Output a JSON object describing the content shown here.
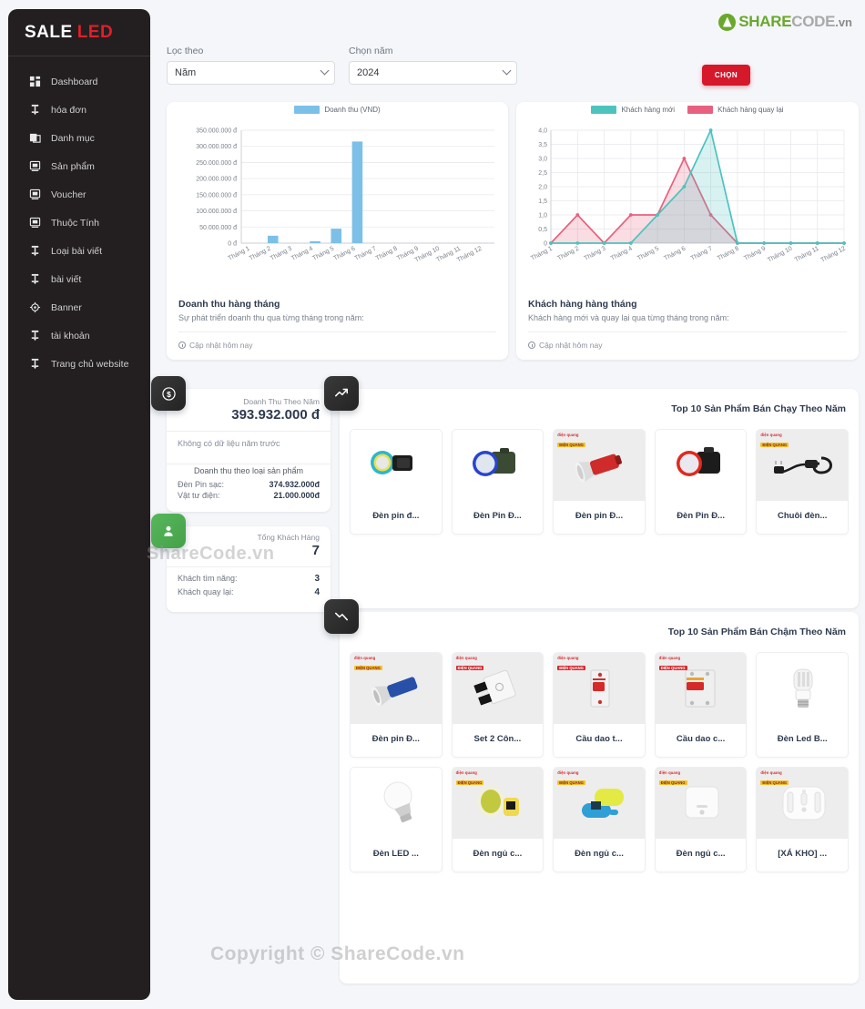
{
  "brand": {
    "part1": "SALE",
    "part2": "LED"
  },
  "sidebar": {
    "items": [
      {
        "label": "Dashboard",
        "icon": "dashboard-grid-icon"
      },
      {
        "label": "hóa đơn",
        "icon": "invoice-icon"
      },
      {
        "label": "Danh mục",
        "icon": "category-icon"
      },
      {
        "label": "Sản phẩm",
        "icon": "product-icon"
      },
      {
        "label": "Voucher",
        "icon": "voucher-icon"
      },
      {
        "label": "Thuộc Tính",
        "icon": "attribute-icon"
      },
      {
        "label": "Loại bài viết",
        "icon": "post-type-icon"
      },
      {
        "label": "bài viết",
        "icon": "post-icon"
      },
      {
        "label": "Banner",
        "icon": "banner-icon"
      },
      {
        "label": "tài khoản",
        "icon": "account-icon"
      },
      {
        "label": "Trang chủ website",
        "icon": "home-icon"
      }
    ]
  },
  "logo": {
    "share": "SHARE",
    "code": "CODE",
    "vn": ".vn"
  },
  "filters": {
    "filter_by_label": "Lọc theo",
    "filter_by_value": "Năm",
    "year_label": "Chọn năm",
    "year_value": "2024",
    "submit_label": "CHỌN",
    "submit_color": "#d6182b"
  },
  "revenue_card": {
    "title": "Doanh thu hàng tháng",
    "subtitle": "Sự phát triển doanh thu qua từng tháng trong năm:",
    "footer": "Cập nhật hôm nay"
  },
  "customer_card": {
    "title": "Khách hàng hàng tháng",
    "subtitle": "Khách hàng mới và quay lại qua từng tháng trong năm:",
    "footer": "Cập nhật hôm nay"
  },
  "chart_data": [
    {
      "type": "bar",
      "title": "",
      "legend": [
        "Doanh thu (VND)"
      ],
      "legend_position": "top",
      "color": "#7cc0e8",
      "categories": [
        "Tháng 1",
        "Tháng 2",
        "Tháng 3",
        "Tháng 4",
        "Tháng 5",
        "Tháng 6",
        "Tháng 7",
        "Tháng 8",
        "Tháng 9",
        "Tháng 10",
        "Tháng 11",
        "Tháng 12"
      ],
      "values": [
        0,
        23000000,
        0,
        6000000,
        45000000,
        315000000,
        0,
        0,
        0,
        0,
        0,
        0
      ],
      "ytick_labels": [
        "0 đ",
        "50.000.000 đ",
        "100.000.000 đ",
        "150.000.000 đ",
        "200.000.000 đ",
        "250.000.000 đ",
        "300.000.000 đ",
        "350.000.000 đ"
      ],
      "ylim": [
        0,
        350000000
      ],
      "xlabel": "",
      "ylabel": "",
      "grid": true
    },
    {
      "type": "area",
      "title": "",
      "legend_position": "top",
      "categories": [
        "Tháng 1",
        "Tháng 2",
        "Tháng 3",
        "Tháng 4",
        "Tháng 5",
        "Tháng 6",
        "Tháng 7",
        "Tháng 8",
        "Tháng 9",
        "Tháng 10",
        "Tháng 11",
        "Tháng 12"
      ],
      "series": [
        {
          "name": "Khách hàng mới",
          "color": "#4ec3bd",
          "values": [
            0,
            0,
            0,
            0,
            1,
            2,
            4,
            0,
            0,
            0,
            0,
            0
          ]
        },
        {
          "name": "Khách hàng quay lại",
          "color": "#e8607f",
          "values": [
            0,
            1,
            0,
            1,
            1,
            3,
            1,
            0,
            0,
            0,
            0,
            0
          ]
        }
      ],
      "ytick_labels": [
        "0",
        "0,5",
        "1,0",
        "1,5",
        "2,0",
        "2,5",
        "3,0",
        "3,5",
        "4,0"
      ],
      "ylim": [
        0,
        4
      ],
      "xlabel": "",
      "ylabel": "",
      "grid": true
    }
  ],
  "stat_revenue": {
    "icon": "dollar-icon",
    "label": "Doanh Thu Theo Năm",
    "value": "393.932.000 đ",
    "note": "Không có dữ liệu năm trước",
    "breakdown_title": "Doanh thu theo loại sản phẩm",
    "rows": [
      {
        "label": "Đèn Pin sạc:",
        "value": "374.932.000đ"
      },
      {
        "label": "Vật tư điện:",
        "value": "21.000.000đ"
      }
    ]
  },
  "stat_customer": {
    "icon": "user-icon",
    "icon_color": "#4caf50",
    "label": "Tổng Khách Hàng",
    "value": "7",
    "rows": [
      {
        "label": "Khách tìm năng:",
        "value": "3"
      },
      {
        "label": "Khách quay lại:",
        "value": "4"
      }
    ]
  },
  "panel_top": {
    "icon": "trend-up-icon",
    "title": "Top 10 Sản Phẩm Bán Chạy Theo Năm",
    "products": [
      {
        "name": "Đèn pin đ...",
        "img": "headlamp-cyan",
        "badge": false
      },
      {
        "name": "Đèn Pin Đ...",
        "img": "headlamp-blue",
        "badge": false
      },
      {
        "name": "Đèn pin Đ...",
        "img": "flashlight-red",
        "badge": true,
        "badge_style": "yellow"
      },
      {
        "name": "Đèn Pin Đ...",
        "img": "headlamp-red",
        "badge": false
      },
      {
        "name": "Chuôi đèn...",
        "img": "lamp-socket-cord",
        "badge": true,
        "badge_style": "yellow"
      }
    ]
  },
  "panel_slow": {
    "icon": "trend-down-icon",
    "title": "Top 10 Sản Phẩm Bán Chậm Theo Năm",
    "products": [
      {
        "name": "Đèn pin Đ...",
        "img": "flashlight-blue",
        "badge": true,
        "badge_style": "yellow"
      },
      {
        "name": "Set 2 Côn...",
        "img": "switch-white",
        "badge": true,
        "badge_style": "red"
      },
      {
        "name": "Cầu dao t...",
        "img": "breaker-1p",
        "badge": true,
        "badge_style": "red"
      },
      {
        "name": "Cầu dao c...",
        "img": "breaker-2p",
        "badge": true,
        "badge_style": "red"
      },
      {
        "name": "Đèn Led B...",
        "img": "led-bulb-tube",
        "badge": false
      },
      {
        "name": "Đèn LED ...",
        "img": "led-bulb-round",
        "badge": false
      },
      {
        "name": "Đèn ngủ c...",
        "img": "nightlight-egg",
        "badge": true,
        "badge_style": "yellow"
      },
      {
        "name": "Đèn ngủ c...",
        "img": "nightlight-capsule",
        "badge": true,
        "badge_style": "yellow"
      },
      {
        "name": "Đèn ngủ c...",
        "img": "nightlight-wall",
        "badge": true,
        "badge_style": "yellow"
      },
      {
        "name": "[XÁ KHO] ...",
        "img": "nightlight-square",
        "badge": true,
        "badge_style": "yellow"
      }
    ]
  },
  "badge_text": {
    "line1": "điện quang",
    "line2": "ĐIỆN QUANG"
  },
  "watermarks": {
    "side": "ShareCode.vn",
    "bottom": "Copyright © ShareCode.vn"
  }
}
